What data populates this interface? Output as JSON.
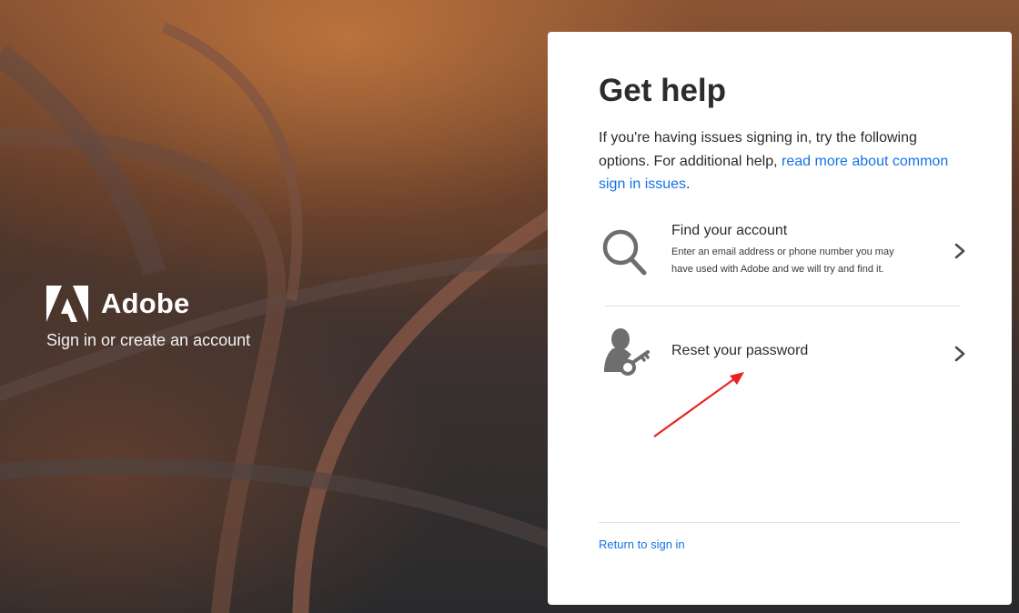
{
  "brand": {
    "name": "Adobe",
    "tagline": "Sign in or create an account"
  },
  "card": {
    "title": "Get help",
    "description_prefix": "If you're having issues signing in, try the following options. For additional help, ",
    "description_link": "read more about common sign in issues",
    "description_suffix": ".",
    "options": [
      {
        "icon": "search-icon",
        "title": "Find your account",
        "description": "Enter an email address or phone number you may have used with Adobe and we will try and find it."
      },
      {
        "icon": "user-key-icon",
        "title": "Reset your password",
        "description": ""
      }
    ],
    "return_link": "Return to sign in"
  },
  "colors": {
    "link": "#1473e6",
    "text": "#2c2c2c",
    "annotation_arrow": "#e8231f"
  }
}
